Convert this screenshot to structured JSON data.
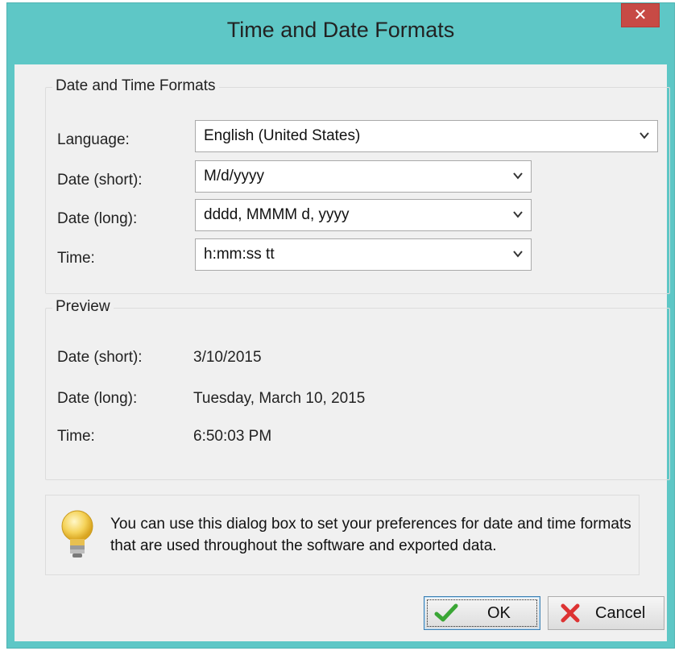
{
  "window": {
    "title": "Time and Date Formats",
    "close_glyph": "✕"
  },
  "formats_group": {
    "legend": "Date and Time Formats",
    "language": {
      "label": "Language:",
      "value": "English (United States)"
    },
    "date_short": {
      "label": "Date (short):",
      "value": "M/d/yyyy"
    },
    "date_long": {
      "label": "Date (long):",
      "value": "dddd, MMMM d, yyyy"
    },
    "time": {
      "label": "Time:",
      "value": "h:mm:ss tt"
    }
  },
  "preview_group": {
    "legend": "Preview",
    "date_short": {
      "label": "Date (short):",
      "value": "3/10/2015"
    },
    "date_long": {
      "label": "Date (long):",
      "value": "Tuesday, March 10, 2015"
    },
    "time": {
      "label": "Time:",
      "value": "6:50:03 PM"
    }
  },
  "tip": {
    "icon": "lightbulb-icon",
    "text": "You can use this dialog box to set your preferences for date and time formats that are used throughout the software and exported data."
  },
  "buttons": {
    "ok": {
      "label": "OK",
      "icon": "checkmark-icon"
    },
    "cancel": {
      "label": "Cancel",
      "icon": "red-x-icon"
    }
  },
  "colors": {
    "titlebar": "#5ec7c6",
    "close": "#c74a45",
    "dialog_bg": "#f0f0f0"
  }
}
